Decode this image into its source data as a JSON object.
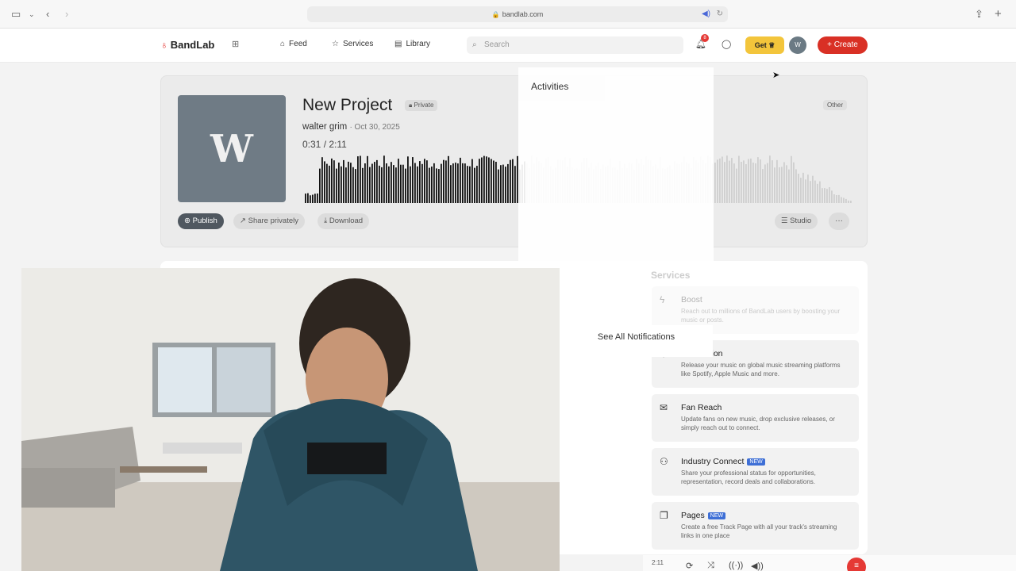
{
  "browser": {
    "url": "bandlab.com"
  },
  "nav": {
    "logo": "BandLab",
    "links": [
      {
        "label": "Feed",
        "icon": "home-icon"
      },
      {
        "label": "Services",
        "icon": "star-icon"
      },
      {
        "label": "Library",
        "icon": "library-icon"
      }
    ],
    "search_placeholder": "Search",
    "notification_count": "8",
    "get_label": "Get",
    "avatar_initial": "W",
    "create_label": "Create"
  },
  "project": {
    "title": "New Project",
    "privacy": "Private",
    "owner": "walter grim",
    "date": "· Oct 30, 2025",
    "time_current": "0:31",
    "time_total": "2:11",
    "genre": "Other",
    "cover_letter": "W",
    "progress_fraction": 0.24,
    "actions": [
      "Publish",
      "Share privately",
      "Download",
      "Studio"
    ]
  },
  "notifications": {
    "title": "Activities",
    "see_all": "See All Notifications"
  },
  "services": {
    "heading": "Services",
    "items": [
      {
        "title": "Boost",
        "desc": "Reach out to millions of BandLab users by boosting your music or posts.",
        "icon": "bolt-icon",
        "is_new": false
      },
      {
        "title": "Distribution",
        "desc": "Release your music on global music streaming platforms like Spotify, Apple Music and more.",
        "icon": "globe-icon",
        "is_new": false
      },
      {
        "title": "Fan Reach",
        "desc": "Update fans on new music, drop exclusive releases, or simply reach out to connect.",
        "icon": "mail-icon",
        "is_new": false
      },
      {
        "title": "Industry Connect",
        "desc": "Share your professional status for opportunities, representation, record deals and collaborations.",
        "icon": "people-icon",
        "is_new": true
      },
      {
        "title": "Pages",
        "desc": "Create a free Track Page with all your track's streaming links in one place",
        "icon": "pages-icon",
        "is_new": true
      }
    ],
    "new_label": "NEW"
  },
  "player": {
    "time": "2:11"
  },
  "colors": {
    "brand_red": "#e53935",
    "get_yellow": "#f3c53b",
    "new_blue": "#3e6fd6"
  }
}
